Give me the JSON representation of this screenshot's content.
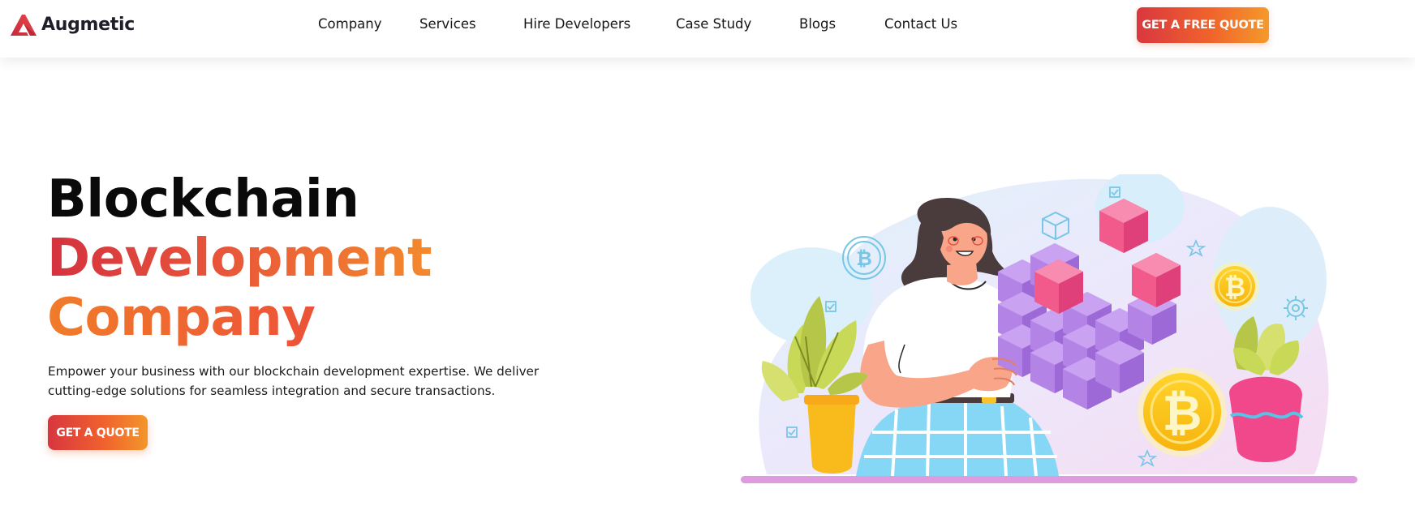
{
  "brand": {
    "name": "Augmetic",
    "colors": {
      "red": "#d9373f",
      "orange": "#f49a2a",
      "dark": "#1f1f2b"
    }
  },
  "nav": {
    "items": [
      {
        "label": "Company"
      },
      {
        "label": "Services"
      },
      {
        "label": "Hire Developers"
      },
      {
        "label": "Case Study"
      },
      {
        "label": "Blogs"
      },
      {
        "label": "Contact Us"
      }
    ],
    "cta_label": "GET A FREE QUOTE"
  },
  "hero": {
    "title_line1": "Blockchain",
    "title_line2": "Development",
    "title_line3": "Company",
    "description": "Empower your business with our blockchain development expertise. We deliver cutting-edge solutions for seamless integration and secure transactions.",
    "cta_label": "GET A QUOTE"
  },
  "illustration": {
    "icons": [
      "bitcoin-icon",
      "cube-icon",
      "checkbox-icon",
      "star-icon",
      "gear-icon",
      "plant-icon"
    ]
  }
}
